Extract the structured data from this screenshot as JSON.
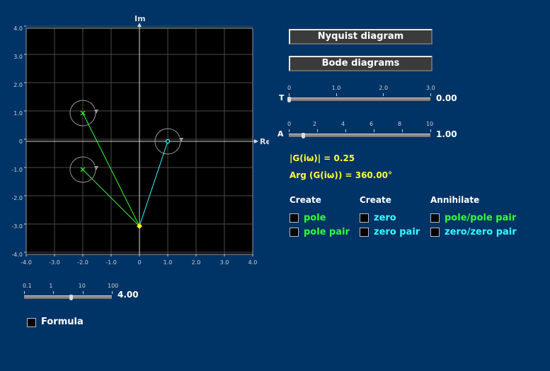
{
  "plot": {
    "x_label": "Im_re",
    "axis_im_label": "Im",
    "axis_re_label": "Re",
    "y_ticks": [
      "4.0",
      "3.0",
      "2.0",
      "1.0",
      "0",
      "-1.0",
      "-2.0",
      "-3.0",
      "-4.0"
    ],
    "x_ticks": [
      "-4.0",
      "-3.0",
      "-2.0",
      "-1.0",
      "0",
      "1.0",
      "2.0",
      "3.0",
      "4.0"
    ],
    "poles": [
      {
        "re": -2,
        "im": 1
      },
      {
        "re": -2,
        "im": -1
      }
    ],
    "zeros": [
      {
        "re": 1,
        "im": 0
      }
    ],
    "probe": {
      "re": 0,
      "im": -3
    },
    "colors": {
      "pole": "#33ff33",
      "zero": "#33ffff",
      "probe": "#ffff00",
      "grid": "#4a4a4a",
      "axis": "#d8d8d8",
      "background": "#000000"
    }
  },
  "buttons": {
    "nyquist": "Nyquist diagram",
    "bode": "Bode diagrams"
  },
  "slider_t": {
    "label": "T",
    "ticks": [
      "0",
      "1.0",
      "2.0",
      "3.0"
    ],
    "value": "0.00",
    "fraction": 0.0
  },
  "slider_a": {
    "label": "A",
    "ticks": [
      "0",
      "2",
      "4",
      "6",
      "8",
      "10"
    ],
    "value": "1.00",
    "fraction": 0.1
  },
  "slider_freq": {
    "ticks": [
      "0.1",
      "1",
      "10",
      "100"
    ],
    "value": "4.00",
    "fraction": 0.53
  },
  "info": {
    "magnitude": "|G(iω)| = 0.25",
    "argument": "Arg (G(iω)) = 360.00°"
  },
  "columns": {
    "create1": "Create",
    "create2": "Create",
    "annihilate": "Annihilate"
  },
  "checkboxes": {
    "pole": "pole",
    "pole_pair": "pole pair",
    "zero": "zero",
    "zero_pair": "zero pair",
    "pole_pole_pair": "pole/pole pair",
    "zero_zero_pair": "zero/zero pair"
  },
  "formula": "Formula"
}
